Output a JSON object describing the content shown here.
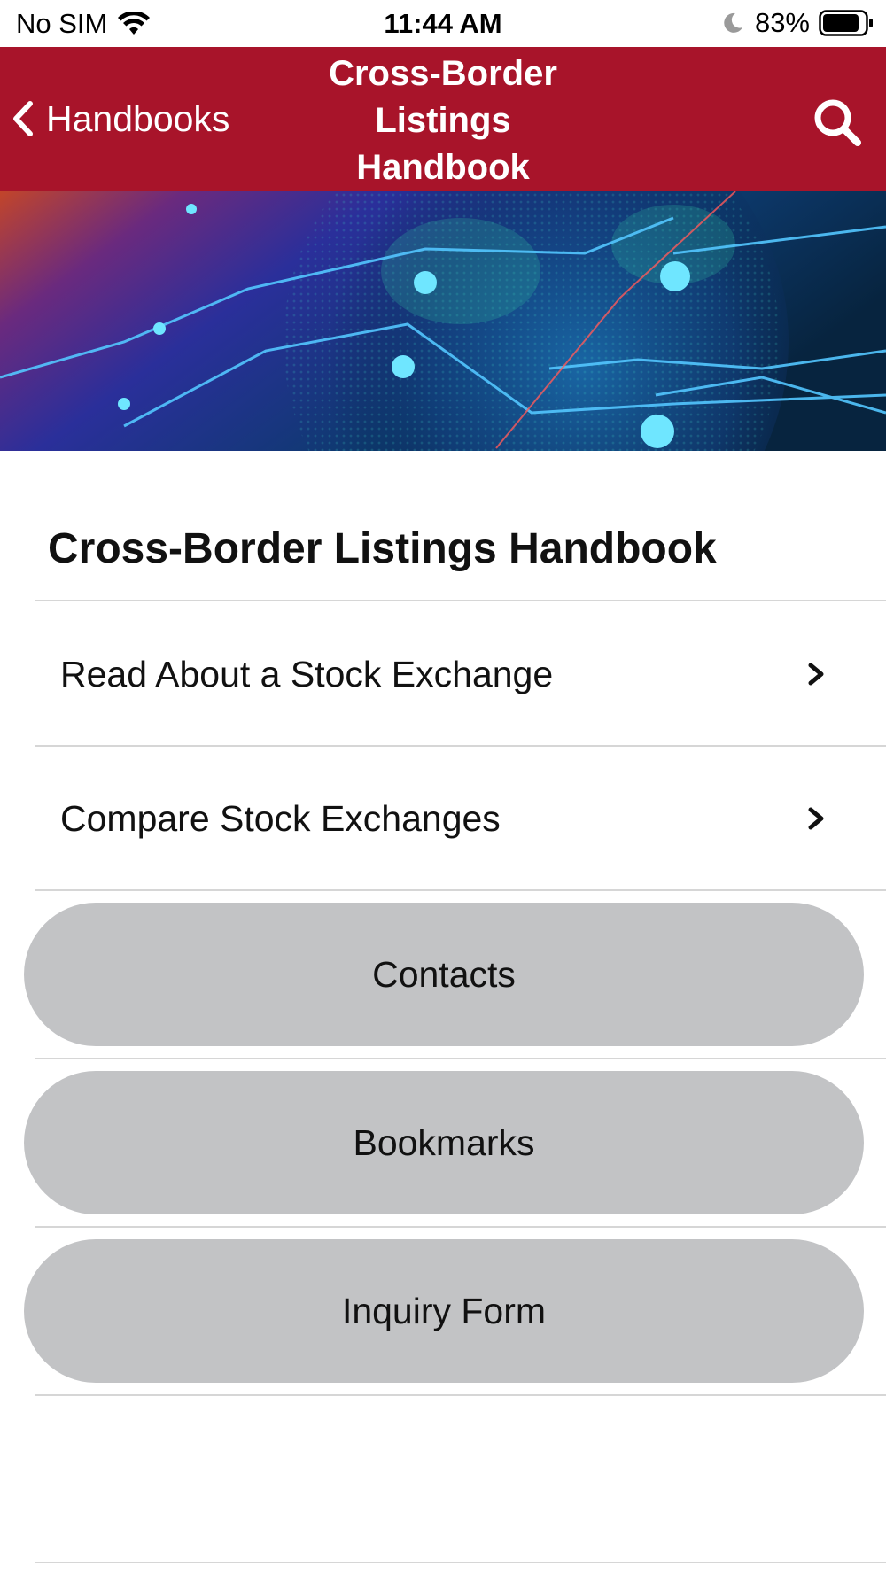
{
  "status_bar": {
    "carrier": "No SIM",
    "time": "11:44 AM",
    "battery_percent": "83%",
    "icons": [
      "wifi-icon",
      "moon-icon",
      "battery-icon"
    ]
  },
  "nav": {
    "back_label": "Handbooks",
    "title_lines": [
      "Cross-Border",
      "Listings",
      "Handbook"
    ],
    "back_icon": "chevron-left-icon",
    "search_icon": "search-icon"
  },
  "hero": {
    "image": "globe-network-banner"
  },
  "main": {
    "title": "Cross-Border Listings Handbook",
    "rows": [
      {
        "label": "Read About a Stock Exchange",
        "icon": "chevron-right-icon"
      },
      {
        "label": "Compare Stock Exchanges",
        "icon": "chevron-right-icon"
      }
    ],
    "buttons": [
      {
        "label": "Contacts"
      },
      {
        "label": "Bookmarks"
      },
      {
        "label": "Inquiry Form"
      }
    ]
  },
  "colors": {
    "nav_background": "#a8142a",
    "pill_background": "#c2c3c5",
    "divider": "#d6d6d6"
  }
}
